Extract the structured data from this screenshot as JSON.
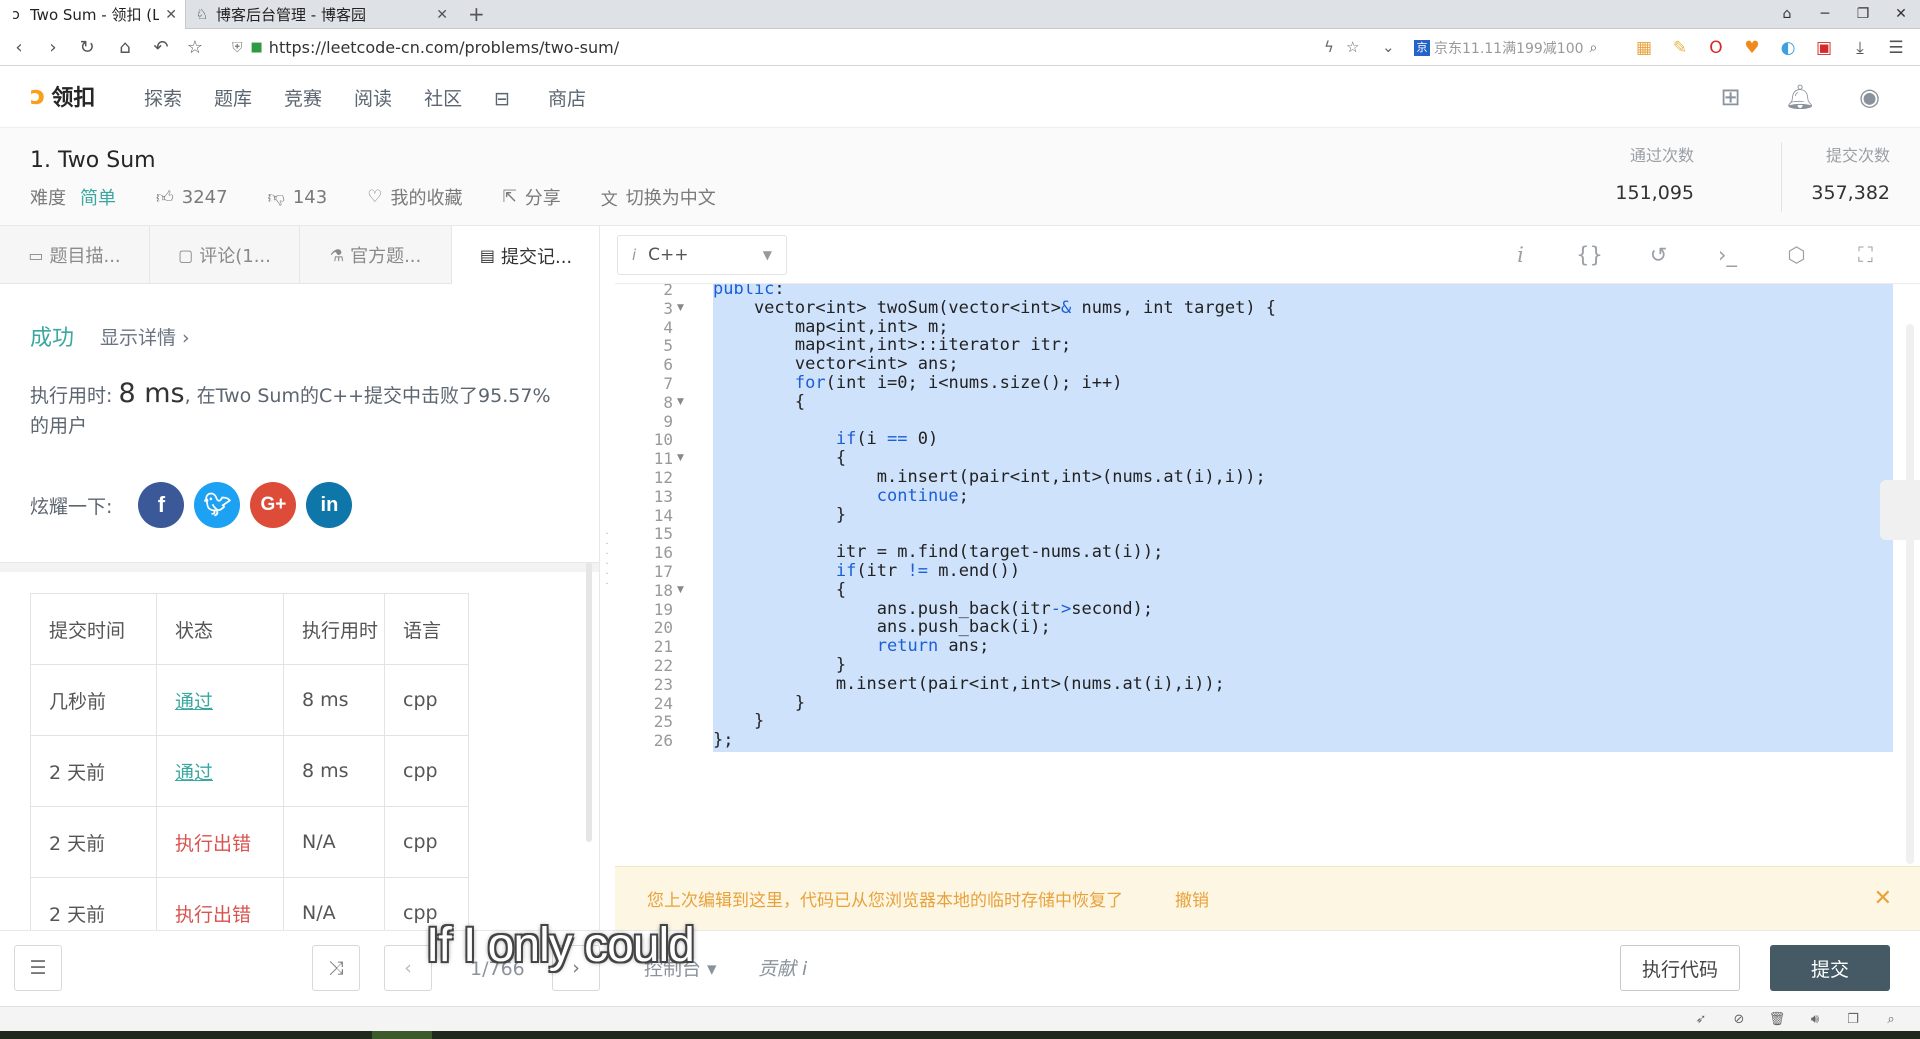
{
  "browser": {
    "tabs": [
      {
        "title": "Two Sum - 领扣 (LeetCo",
        "icon": "leetcode-logo",
        "active": true
      },
      {
        "title": "博客后台管理 - 博客园",
        "icon": "cnblogs-logo",
        "active": false
      }
    ],
    "url": "https://leetcode-cn.com/problems/two-sum/",
    "jd_search": "京东11.11满199减100"
  },
  "nav": {
    "logo_text": "领扣",
    "items": [
      "探索",
      "题库",
      "竞赛",
      "阅读",
      "社区"
    ],
    "store": "商店"
  },
  "problem": {
    "title": "1.  Two Sum",
    "difficulty_label": "难度",
    "difficulty": "简单",
    "likes": "3247",
    "dislikes": "143",
    "favorite": "我的收藏",
    "share": "分享",
    "switch_lang": "切换为中文",
    "accepted_label": "通过次数",
    "accepted": "151,095",
    "submissions_label": "提交次数",
    "submissions": "357,382"
  },
  "left_tabs": [
    "题目描...",
    "评论(1...",
    "官方题...",
    "提交记..."
  ],
  "result": {
    "status": "成功",
    "detail": "显示详情 ›",
    "exec_prefix": "执行用时: ",
    "exec_time": "8 ms",
    "exec_suffix": ", 在Two Sum的C++提交中击败了95.57% 的用户",
    "share_label": "炫耀一下:"
  },
  "submissions_table": {
    "headers": [
      "提交时间",
      "状态",
      "执行用时",
      "语言"
    ],
    "rows": [
      [
        "几秒前",
        "通过",
        "8 ms",
        "cpp"
      ],
      [
        "2 天前",
        "通过",
        "8 ms",
        "cpp"
      ],
      [
        "2 天前",
        "执行出错",
        "N/A",
        "cpp"
      ],
      [
        "2 天前",
        "执行出错",
        "N/A",
        "cpp"
      ]
    ]
  },
  "editor": {
    "language": "C++",
    "lines": [
      {
        "n": "2",
        "code": "public:"
      },
      {
        "n": "3",
        "code": "    vector<int> twoSum(vector<int>& nums, int target) {",
        "fold": true
      },
      {
        "n": "4",
        "code": "        map<int,int> m;"
      },
      {
        "n": "5",
        "code": "        map<int,int>::iterator itr;"
      },
      {
        "n": "6",
        "code": "        vector<int> ans;"
      },
      {
        "n": "7",
        "code": "        for(int i=0; i<nums.size(); i++)"
      },
      {
        "n": "8",
        "code": "        {",
        "fold": true
      },
      {
        "n": "9",
        "code": ""
      },
      {
        "n": "10",
        "code": "            if(i == 0)"
      },
      {
        "n": "11",
        "code": "            {",
        "fold": true
      },
      {
        "n": "12",
        "code": "                m.insert(pair<int,int>(nums.at(i),i));"
      },
      {
        "n": "13",
        "code": "                continue;"
      },
      {
        "n": "14",
        "code": "            }"
      },
      {
        "n": "15",
        "code": ""
      },
      {
        "n": "16",
        "code": "            itr = m.find(target-nums.at(i));"
      },
      {
        "n": "17",
        "code": "            if(itr != m.end())"
      },
      {
        "n": "18",
        "code": "            {",
        "fold": true
      },
      {
        "n": "19",
        "code": "                ans.push_back(itr->second);"
      },
      {
        "n": "20",
        "code": "                ans.push_back(i);"
      },
      {
        "n": "21",
        "code": "                return ans;"
      },
      {
        "n": "22",
        "code": "            }"
      },
      {
        "n": "23",
        "code": "            m.insert(pair<int,int>(nums.at(i),i));"
      },
      {
        "n": "24",
        "code": "        }"
      },
      {
        "n": "25",
        "code": "    }"
      },
      {
        "n": "26",
        "code": "};"
      }
    ]
  },
  "notice": {
    "message": "您上次编辑到这里，代码已从您浏览器本地的临时存储中恢复了",
    "undo": "撤销"
  },
  "bottom": {
    "page": "1/766",
    "console": "控制台 ▾",
    "contribute": "贡献 i",
    "run": "执行代码",
    "submit": "提交"
  },
  "caption": "If I only could",
  "colors": {
    "accent": "#3aa8a0",
    "error": "#d9534f",
    "submit_bg": "#455a64",
    "selection": "#cfe2fb",
    "store": "#f0a020"
  }
}
